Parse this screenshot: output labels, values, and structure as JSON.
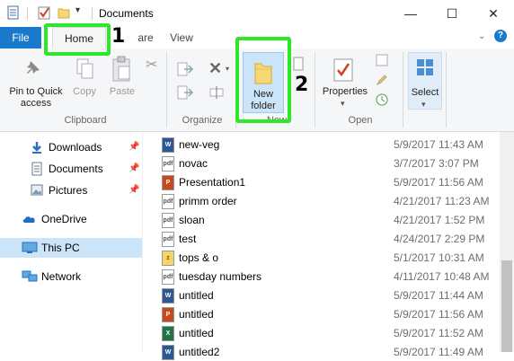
{
  "window": {
    "title": "Documents",
    "minimize_glyph": "—",
    "maximize_glyph": "☐",
    "close_glyph": "✕"
  },
  "ribbon_tabs": {
    "file": "File",
    "home": "Home",
    "share": "are",
    "view": "View"
  },
  "ribbon": {
    "pin_label_1": "Pin to Quick",
    "pin_label_2": "access",
    "copy": "Copy",
    "paste": "Paste",
    "clipboard": "Clipboard",
    "organize": "Organize",
    "new_folder_1": "New",
    "new_folder_2": "folder",
    "new_group": "New",
    "properties": "Properties",
    "open_group": "Open",
    "select": "Select",
    "dropdown_glyph": "▾"
  },
  "annotations": {
    "step1": "1",
    "step2": "2",
    "highlight_color": "#2ee72a"
  },
  "nav": {
    "downloads": "Downloads",
    "documents": "Documents",
    "pictures": "Pictures",
    "onedrive": "OneDrive",
    "thispc": "This PC",
    "network": "Network"
  },
  "files": [
    {
      "name": "new-veg",
      "date": "5/9/2017 11:43 AM",
      "type": "W"
    },
    {
      "name": "novac",
      "date": "3/7/2017 3:07 PM",
      "type": "pdf"
    },
    {
      "name": "Presentation1",
      "date": "5/9/2017 11:56 AM",
      "type": "P"
    },
    {
      "name": "primm order",
      "date": "4/21/2017 11:23 AM",
      "type": "pdf"
    },
    {
      "name": "sloan",
      "date": "4/21/2017 1:52 PM",
      "type": "pdf"
    },
    {
      "name": "test",
      "date": "4/24/2017 2:29 PM",
      "type": "pdf"
    },
    {
      "name": "tops & o",
      "date": "5/1/2017 10:31 AM",
      "type": "zip"
    },
    {
      "name": "tuesday numbers",
      "date": "4/11/2017 10:48 AM",
      "type": "pdf"
    },
    {
      "name": "untitled",
      "date": "5/9/2017 11:44 AM",
      "type": "W"
    },
    {
      "name": "untitled",
      "date": "5/9/2017 11:56 AM",
      "type": "P"
    },
    {
      "name": "untitled",
      "date": "5/9/2017 11:52 AM",
      "type": "X"
    },
    {
      "name": "untitled2",
      "date": "5/9/2017 11:49 AM",
      "type": "W"
    }
  ]
}
